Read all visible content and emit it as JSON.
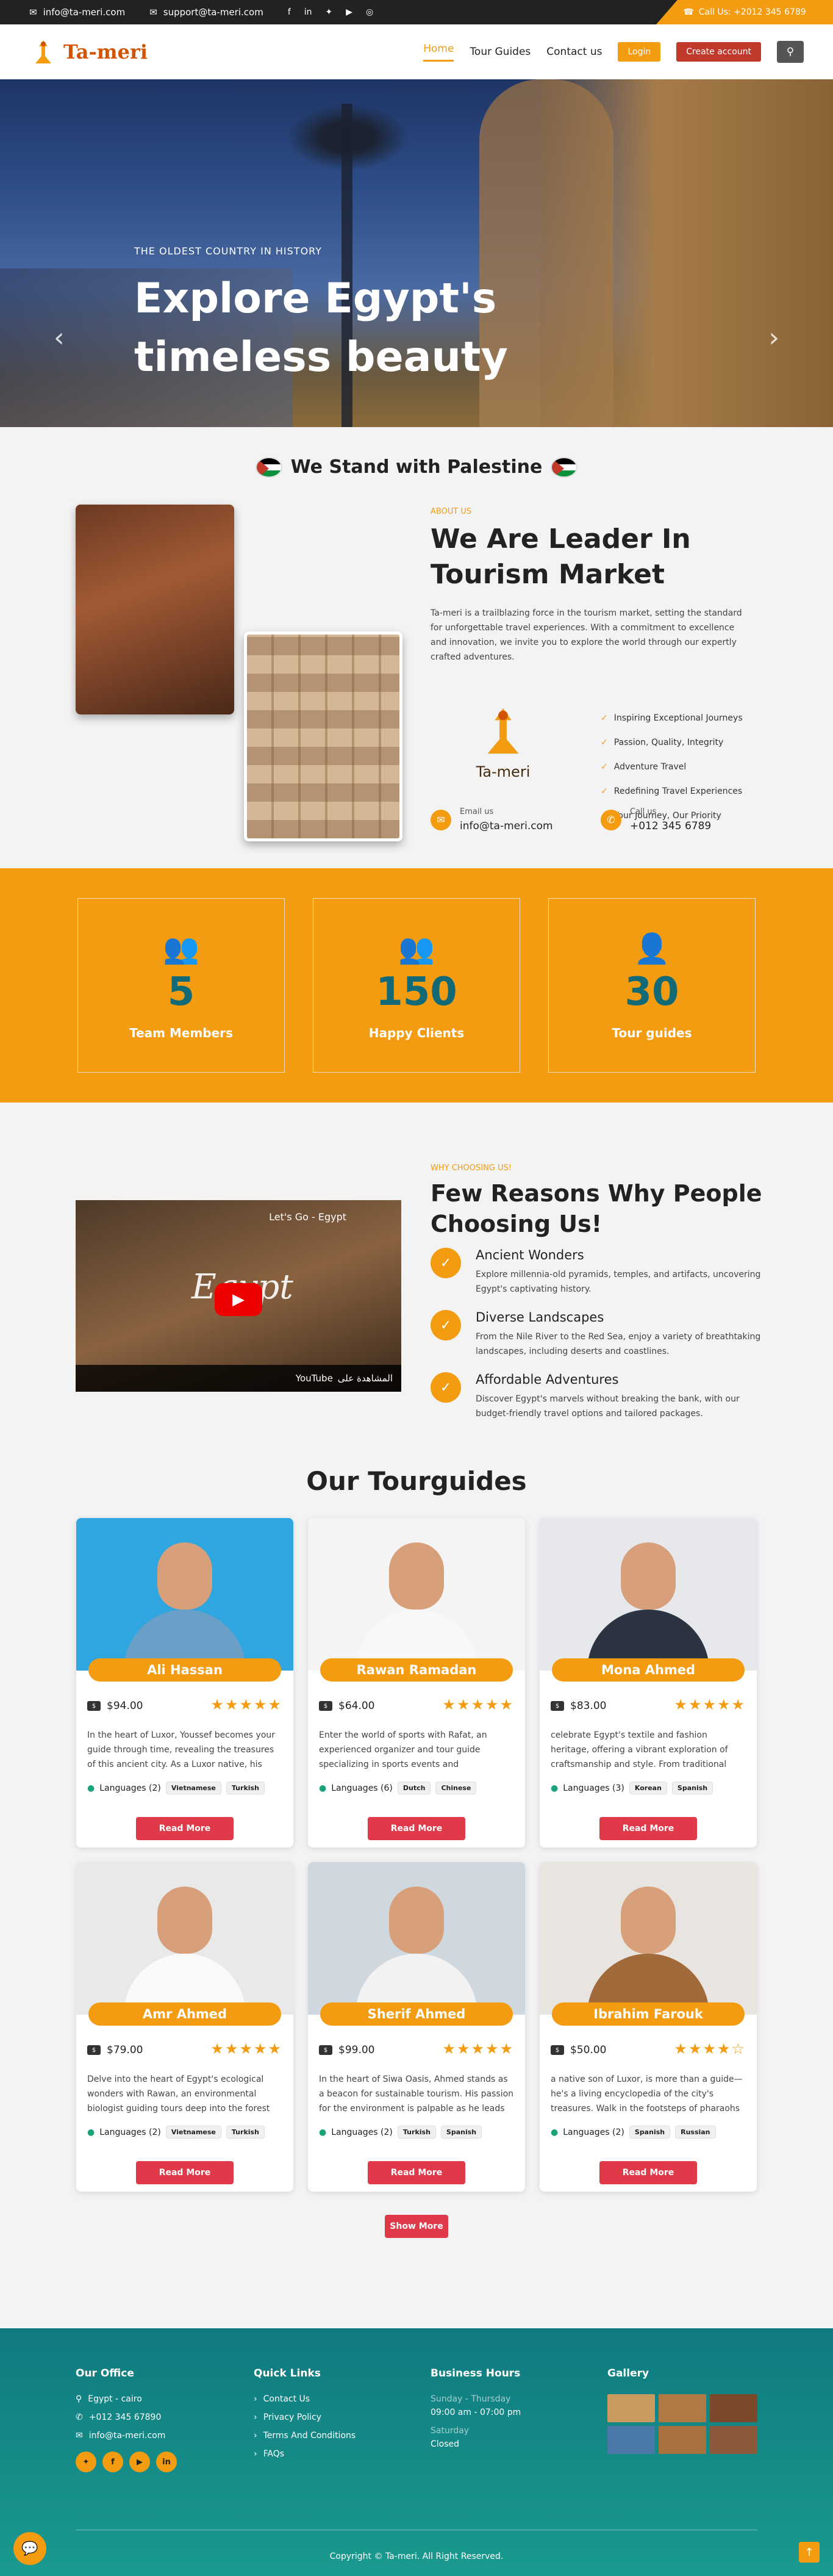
{
  "topbar": {
    "email1": "info@ta-meri.com",
    "email2": "support@ta-meri.com",
    "call": "Call Us: +2012 345 6789"
  },
  "nav": {
    "brand": "Ta-meri",
    "home": "Home",
    "tours": "Tour Guides",
    "contact": "Contact us",
    "login": "Login",
    "create": "Create account"
  },
  "hero": {
    "sub": "THE OLDEST COUNTRY IN HISTORY",
    "title": "Explore Egypt's timeless beauty"
  },
  "palestine": "We Stand with Palestine",
  "about": {
    "label": "ABOUT US",
    "title": "We Are Leader In Tourism Market",
    "text": "Ta-meri is a trailblazing force in the tourism market, setting the standard for unforgettable travel experiences. With a commitment to excellence and innovation, we invite you to explore the world through our expertly crafted adventures.",
    "logo_text": "Ta-meri",
    "list": [
      "Inspiring Exceptional Journeys",
      "Passion, Quality, Integrity",
      "Adventure Travel",
      "Redefining Travel Experiences",
      "Your Journey, Our Priority"
    ],
    "email_label": "Email us",
    "email": "info@ta-meri.com",
    "call_label": "Call us",
    "phone": "+012 345 6789"
  },
  "stats": [
    {
      "num": "5",
      "label": "Team Members",
      "icon": "team-icon"
    },
    {
      "num": "150",
      "label": "Happy Clients",
      "icon": "clients-icon"
    },
    {
      "num": "30",
      "label": "Tour guides",
      "icon": "guide-icon"
    }
  ],
  "why": {
    "label": "WHY CHOOSING US!",
    "title": "Few Reasons Why People Choosing Us!",
    "video_title": "Let's Go - Egypt",
    "video_egypt": "Egypt",
    "video_bar": "المشاهدة على",
    "video_youtube": "YouTube",
    "reasons": [
      {
        "title": "Ancient Wonders",
        "text": "Explore millennia-old pyramids, temples, and artifacts, uncovering Egypt's captivating history."
      },
      {
        "title": "Diverse Landscapes",
        "text": "From the Nile River to the Red Sea, enjoy a variety of breathtaking landscapes, including deserts and coastlines."
      },
      {
        "title": "Affordable Adventures",
        "text": "Discover Egypt's marvels without breaking the bank, with our budget-friendly travel options and tailored packages."
      }
    ]
  },
  "tourguides": {
    "title": "Our Tourguides",
    "read_more": "Read More",
    "show_more": "Show More",
    "cards": [
      {
        "name": "Ali Hassan",
        "price": "$94.00",
        "stars": "★★★★★",
        "desc": "In the heart of Luxor, Youssef becomes your guide through time, revealing the treasures of this ancient city. As a Luxor native, his tours ar...",
        "langs": "Languages (2)",
        "chips": [
          "Vietnamese",
          "Turkish"
        ],
        "bg": "#2fa6e0",
        "shirt": "#6a9fc8"
      },
      {
        "name": "Rawan Ramadan",
        "price": "$64.00",
        "stars": "★★★★★",
        "desc": "Enter the world of sports with Rafat, an experienced organizer and tour guide specializing in sports events and competitions...",
        "langs": "Languages (6)",
        "chips": [
          "Dutch",
          "Chinese"
        ],
        "bg": "#f4f4f4",
        "shirt": "#f8f8f8"
      },
      {
        "name": "Mona Ahmed",
        "price": "$83.00",
        "stars": "★★★★★",
        "desc": "celebrate Egypt's textile and fashion heritage, offering a vibrant exploration of craftsmanship and style. From traditional crafts to...",
        "langs": "Languages (3)",
        "chips": [
          "Korean",
          "Spanish"
        ],
        "bg": "#e6e8ec",
        "shirt": "#2b3440"
      },
      {
        "name": "Amr Ahmed",
        "price": "$79.00",
        "stars": "★★★★★",
        "desc": "Delve into the heart of Egypt's ecological wonders with Rawan, an environmental biologist guiding tours deep into the forest an...",
        "langs": "Languages (2)",
        "chips": [
          "Vietnamese",
          "Turkish"
        ],
        "bg": "#e9e9ea",
        "shirt": "#fafafa"
      },
      {
        "name": "Sherif Ahmed",
        "price": "$99.00",
        "stars": "★★★★★",
        "desc": "In the heart of Siwa Oasis, Ahmed stands as a beacon for sustainable tourism. His passion for the environment is palpable as he leads eco-...",
        "langs": "Languages (2)",
        "chips": [
          "Turkish",
          "Spanish"
        ],
        "bg": "#cfd8de",
        "shirt": "#f2f2f2"
      },
      {
        "name": "Ibrahim Farouk",
        "price": "$50.00",
        "stars": "★★★★☆",
        "desc": "a native son of Luxor, is more than a guide—he's a living encyclopedia of the city's treasures. Walk in the footsteps of pharaohs as Youssef...",
        "langs": "Languages (2)",
        "chips": [
          "Spanish",
          "Russian"
        ],
        "bg": "#e8e4df",
        "shirt": "#a06a3a"
      }
    ]
  },
  "footer": {
    "office_title": "Our Office",
    "address": "Egypt - cairo",
    "phone": "+012 345 67890",
    "email": "info@ta-meri.com",
    "links_title": "Quick Links",
    "links": [
      "Contact Us",
      "Privacy Policy",
      "Terms And Conditions",
      "FAQs"
    ],
    "hours_title": "Business Hours",
    "days1": "Sunday - Thursday",
    "hours1": "09:00 am - 07:00 pm",
    "days2": "Saturday",
    "hours2": "Closed",
    "gallery_title": "Gallery",
    "copyright": "Copyright © Ta-meri. All Right Reserved."
  },
  "colors": {
    "accent": "#f39c12",
    "danger": "#e0394a",
    "teal": "#136a77"
  }
}
